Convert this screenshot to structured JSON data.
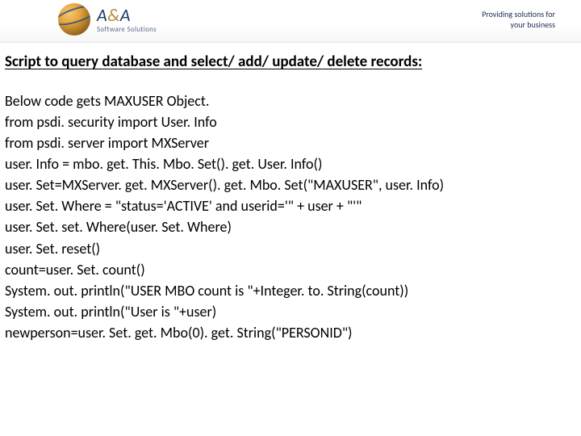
{
  "header": {
    "brand_main": "A&A",
    "brand_sub": "Software Solutions",
    "tagline_l1": "Providing solutions for",
    "tagline_l2": "your business"
  },
  "main": {
    "heading": "Script to query database and select/ add/ update/ delete records:",
    "intro": "Below code gets MAXUSER Object.",
    "code": [
      "from psdi. security import User. Info",
      "from psdi. server import MXServer",
      "user. Info = mbo. get. This. Mbo. Set(). get. User. Info()",
      "user. Set=MXServer. get. MXServer(). get. Mbo. Set(\"MAXUSER\", user. Info)",
      "user. Set. Where = \"status='ACTIVE' and userid='\" + user + \"'\"",
      "user. Set. set. Where(user. Set. Where)",
      "user. Set. reset()",
      "count=user. Set. count()",
      "System. out. println(\"USER MBO count is \"+Integer. to. String(count))",
      "System. out. println(\"User is \"+user)",
      "newperson=user. Set. get. Mbo(0). get. String(\"PERSONID\")"
    ]
  }
}
